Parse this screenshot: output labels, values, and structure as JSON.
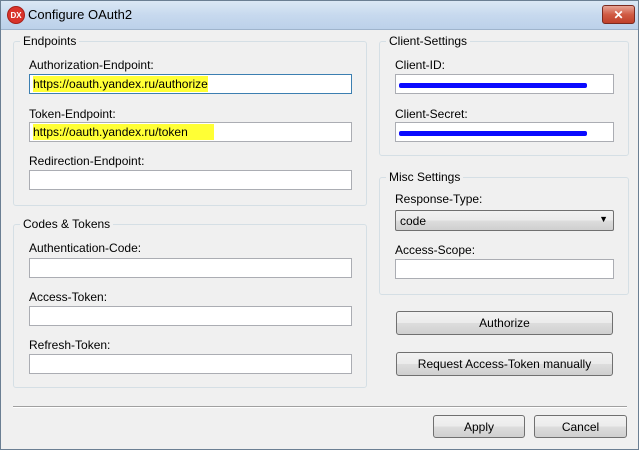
{
  "window": {
    "title": "Configure OAuth2",
    "app_icon_text": "DX",
    "close_glyph": "✕"
  },
  "endpoints": {
    "title": "Endpoints",
    "authorization_label": "Authorization-Endpoint:",
    "authorization_value": "https://oauth.yandex.ru/authorize",
    "token_label": "Token-Endpoint:",
    "token_value": "https://oauth.yandex.ru/token",
    "redirection_label": "Redirection-Endpoint:",
    "redirection_value": ""
  },
  "codes_tokens": {
    "title": "Codes & Tokens",
    "authentication_code_label": "Authentication-Code:",
    "authentication_code_value": "",
    "access_token_label": "Access-Token:",
    "access_token_value": "",
    "refresh_token_label": "Refresh-Token:",
    "refresh_token_value": ""
  },
  "client_settings": {
    "title": "Client-Settings",
    "client_id_label": "Client-ID:",
    "client_secret_label": "Client-Secret:"
  },
  "misc_settings": {
    "title": "Misc Settings",
    "response_type_label": "Response-Type:",
    "response_type_value": "code",
    "access_scope_label": "Access-Scope:",
    "access_scope_value": ""
  },
  "actions": {
    "authorize_label": "Authorize",
    "request_token_label": "Request Access-Token manually",
    "apply_label": "Apply",
    "cancel_label": "Cancel"
  },
  "colors": {
    "highlight": "#ffff35",
    "redaction": "#0a0aff"
  }
}
